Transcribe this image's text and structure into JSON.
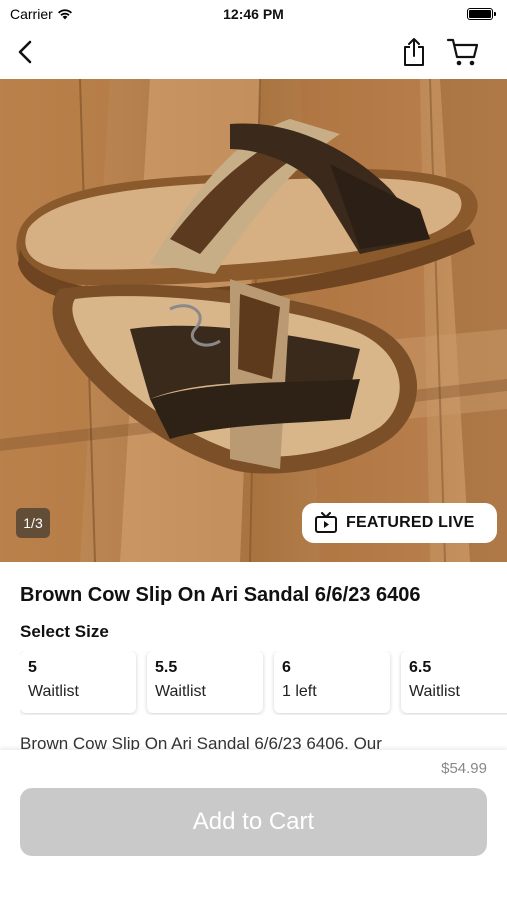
{
  "status_bar": {
    "carrier": "Carrier",
    "time": "12:46 PM"
  },
  "nav": {
    "back_icon": "chevron-left-icon",
    "share_icon": "share-icon",
    "cart_icon": "cart-icon"
  },
  "image": {
    "counter": "1/3",
    "featured_label": "FEATURED LIVE",
    "featured_icon": "live-tv-icon"
  },
  "product": {
    "title": "Brown Cow Slip On Ari Sandal 6/6/23 6406",
    "size_heading": "Select Size",
    "sizes": [
      {
        "size": "5",
        "availability": "Waitlist"
      },
      {
        "size": "5.5",
        "availability": "Waitlist"
      },
      {
        "size": "6",
        "availability": "1 left"
      },
      {
        "size": "6.5",
        "availability": "Waitlist"
      }
    ],
    "description": "Brown Cow Slip On Ari Sandal 6/6/23 6406. Our"
  },
  "checkout": {
    "price": "$54.99",
    "add_to_cart_label": "Add to Cart"
  },
  "colors": {
    "button_disabled": "#c9c9c9",
    "price_text": "#888888"
  }
}
